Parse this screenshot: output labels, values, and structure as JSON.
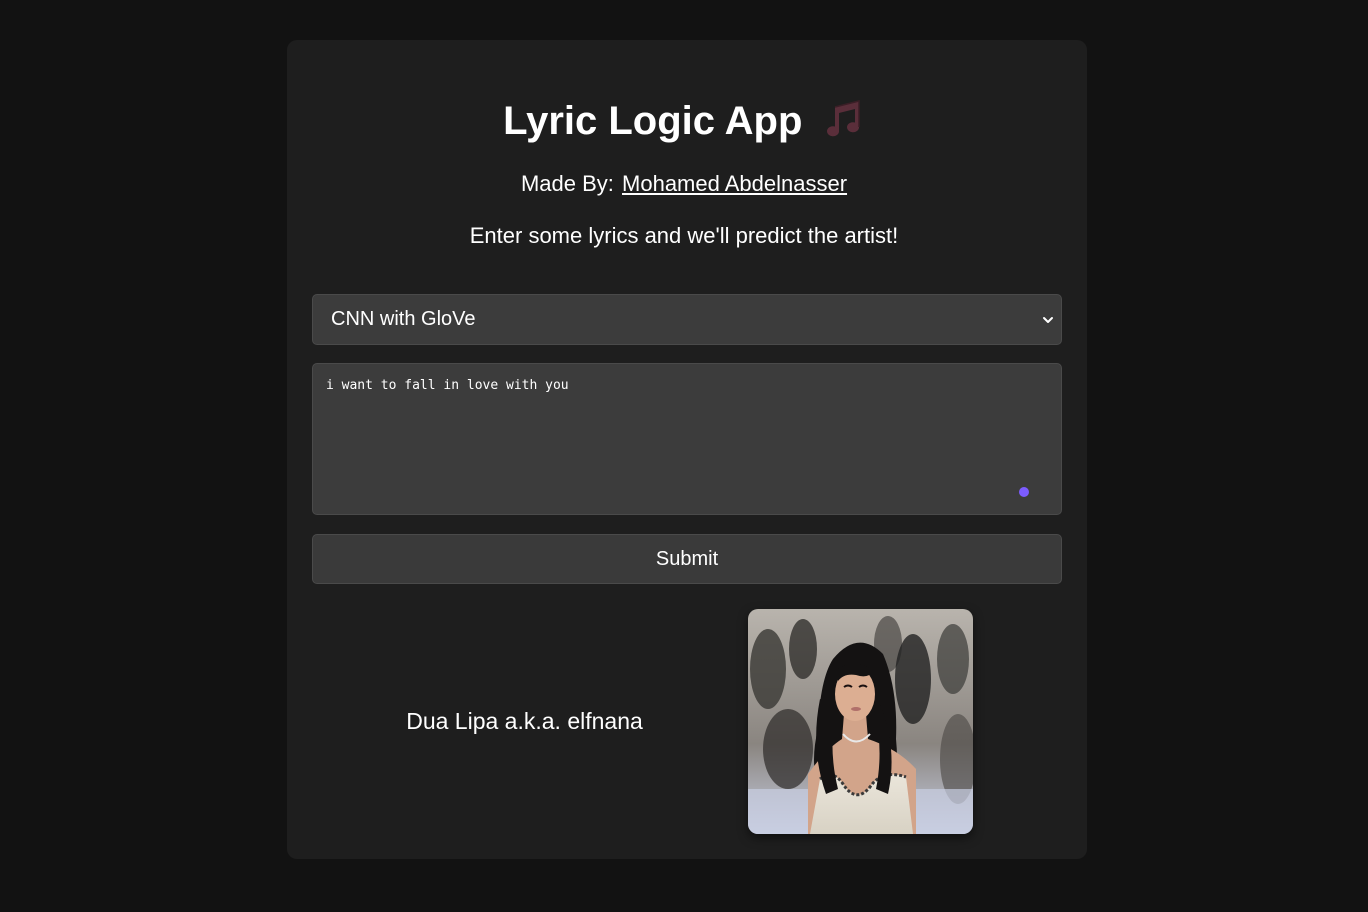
{
  "app": {
    "title": "Lyric Logic App",
    "title_icon": "musical-notes-icon",
    "byline_prefix": "Made By:",
    "author": "Mohamed Abdelnasser",
    "subtitle": "Enter some lyrics and we'll predict the artist!"
  },
  "form": {
    "model_select": {
      "selected": "CNN with GloVe",
      "icon": "chevron-down-icon"
    },
    "lyrics_input": {
      "value": "i want to fall in love with you"
    },
    "submit_label": "Submit"
  },
  "result": {
    "artist_text": "Dua Lipa a.k.a. elfnana",
    "image": "artist-photo"
  },
  "colors": {
    "page_background": "#121212",
    "card_background": "#1e1e1e",
    "input_background": "#3c3c3c",
    "accent_dot": "#7c5cff",
    "title_icon": "#5a2e3a"
  }
}
